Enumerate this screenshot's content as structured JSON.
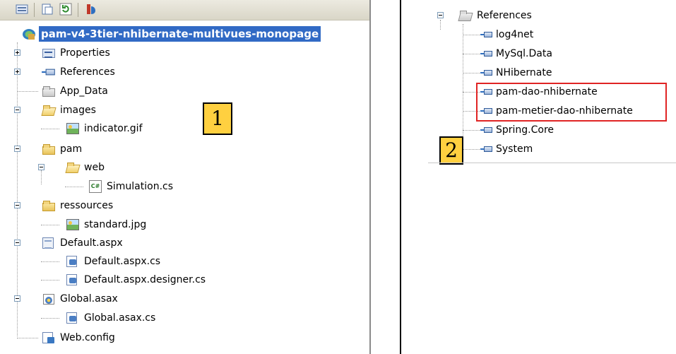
{
  "left_tree": {
    "root": "pam-v4-3tier-nhibernate-multivues-monopage",
    "items": [
      {
        "label": "Properties"
      },
      {
        "label": "References"
      },
      {
        "label": "App_Data"
      },
      {
        "label": "images"
      },
      {
        "label": "indicator.gif"
      },
      {
        "label": "pam"
      },
      {
        "label": "web"
      },
      {
        "label": "Simulation.cs"
      },
      {
        "label": "ressources"
      },
      {
        "label": "standard.jpg"
      },
      {
        "label": "Default.aspx"
      },
      {
        "label": "Default.aspx.cs"
      },
      {
        "label": "Default.aspx.designer.cs"
      },
      {
        "label": "Global.asax"
      },
      {
        "label": "Global.asax.cs"
      },
      {
        "label": "Web.config"
      }
    ]
  },
  "right_tree": {
    "folder": "References",
    "items": [
      {
        "label": "log4net"
      },
      {
        "label": "MySql.Data"
      },
      {
        "label": "NHibernate"
      },
      {
        "label": "pam-dao-nhibernate"
      },
      {
        "label": "pam-metier-dao-nhibernate"
      },
      {
        "label": "Spring.Core"
      },
      {
        "label": "System"
      }
    ]
  },
  "callouts": {
    "one": "1",
    "two": "2"
  },
  "colors": {
    "selection": "#316ac5",
    "callout": "#ffd040",
    "highlight": "#e02424"
  }
}
